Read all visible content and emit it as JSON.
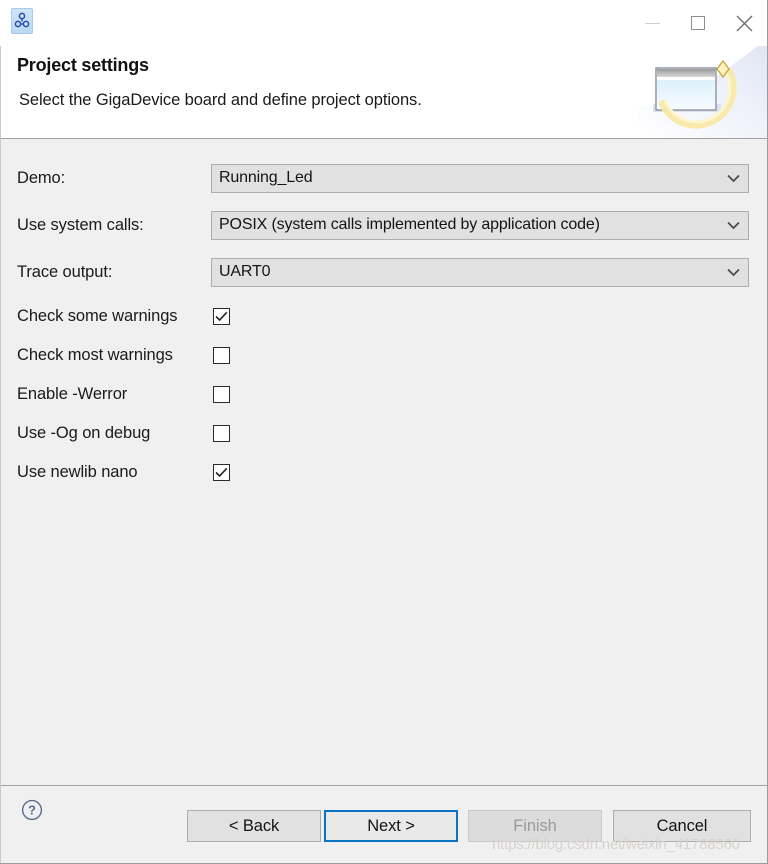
{
  "window": {
    "app_icon_name": "gigadevice-wizard-icon",
    "controls": {
      "minimize_label": "—",
      "maximize_label": "□",
      "close_label": "✕"
    }
  },
  "header": {
    "title": "Project settings",
    "subtitle": "Select the GigaDevice board and define project options.",
    "banner_icon_name": "wizard-window-sparkle-icon"
  },
  "form": {
    "fields": [
      {
        "label": "Demo:",
        "value": "Running_Led",
        "arrow": "chevron-down-icon"
      },
      {
        "label": "Use system calls:",
        "value": "POSIX (system calls implemented by application code)",
        "arrow": "chevron-down-icon"
      },
      {
        "label": "Trace output:",
        "value": "UART0",
        "arrow": "chevron-down-icon"
      }
    ],
    "checkboxes": [
      {
        "label": "Check some warnings",
        "checked": true
      },
      {
        "label": "Check most warnings",
        "checked": false
      },
      {
        "label": "Enable -Werror",
        "checked": false
      },
      {
        "label": "Use -Og on debug",
        "checked": false
      },
      {
        "label": "Use newlib nano",
        "checked": true
      }
    ]
  },
  "footer": {
    "help_icon_name": "help-question-icon",
    "buttons": [
      {
        "label": "< Back",
        "state": "enabled"
      },
      {
        "label": "Next >",
        "state": "focused"
      },
      {
        "label": "Finish",
        "state": "disabled"
      },
      {
        "label": "Cancel",
        "state": "enabled"
      }
    ]
  },
  "watermark": {
    "text": "https://blog.csdn.net/weixin_41788560"
  },
  "colors": {
    "focus_blue": "#0a74c4",
    "body_gray": "#f0f0f0",
    "control_gray": "#e1e1e1",
    "border_gray": "#adadad",
    "text": "#1a1a1a",
    "disabled_text": "#9a9a9a"
  }
}
